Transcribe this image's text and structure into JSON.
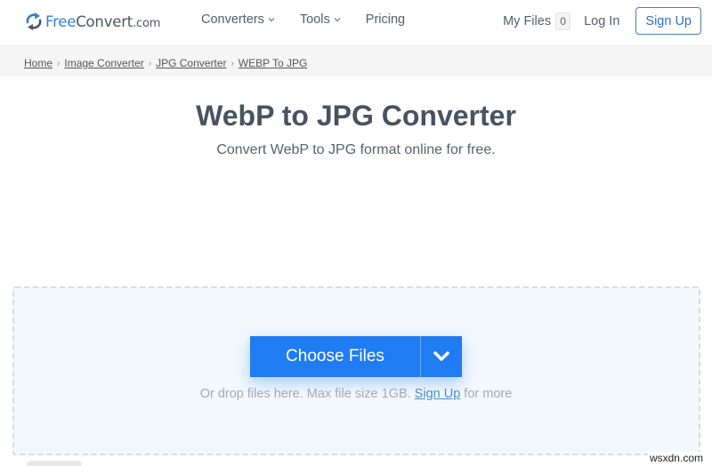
{
  "header": {
    "logo": {
      "icon": "sync-arrows-icon",
      "text_free": "Free",
      "text_convert": "Convert",
      "text_com": ".com"
    },
    "nav": [
      {
        "label": "Converters",
        "has_dropdown": true
      },
      {
        "label": "Tools",
        "has_dropdown": true
      },
      {
        "label": "Pricing",
        "has_dropdown": false
      }
    ],
    "my_files_label": "My Files",
    "my_files_count": "0",
    "login_label": "Log In",
    "signup_label": "Sign Up"
  },
  "breadcrumb": [
    {
      "label": "Home"
    },
    {
      "label": "Image Converter"
    },
    {
      "label": "JPG Converter"
    },
    {
      "label": "WEBP To JPG"
    }
  ],
  "main": {
    "title": "WebP to JPG Converter",
    "subtitle": "Convert WebP to JPG format online for free."
  },
  "upload": {
    "choose_files_label": "Choose Files",
    "dropdown_icon": "chevron-down-icon",
    "drop_text_before": "Or drop files here. Max file size 1GB. ",
    "drop_link": "Sign Up",
    "drop_text_after": " for more"
  },
  "colors": {
    "brand_blue": "#1f7cf2",
    "logo_blue": "#2f80d9",
    "text_dark": "#4a5260",
    "dropzone_bg": "#f3f8fd"
  },
  "watermark": "wsxdn.com"
}
